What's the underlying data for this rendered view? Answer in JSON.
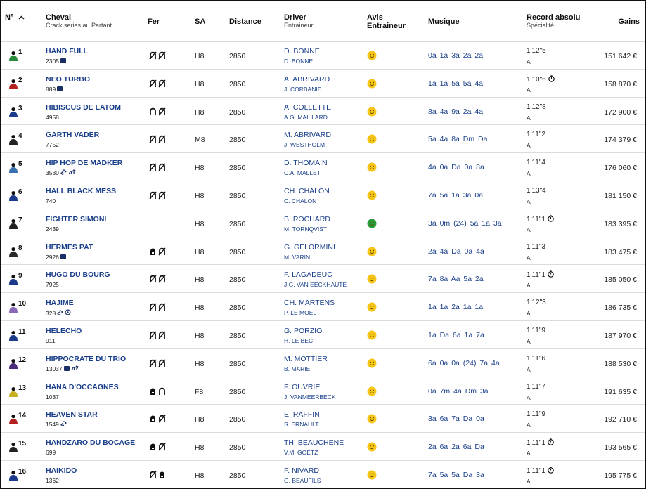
{
  "header": {
    "num_label": "N°",
    "horse_label": "Cheval",
    "horse_sub": "Crack series au Partant",
    "fer_label": "Fer",
    "sa_label": "SA",
    "distance_label": "Distance",
    "driver_label": "Driver",
    "driver_sub": "Entraineur",
    "avis_label": "Avis",
    "avis_label2": "Entraineur",
    "musique_label": "Musique",
    "record_label": "Record absolu",
    "record_sub": "Spécialité",
    "gains_label": "Gains"
  },
  "colors": {
    "link": "#1a3f8a",
    "smiley_neutral": "#f5c518",
    "smiley_good": "#2a9d3a"
  },
  "rows": [
    {
      "num": "1",
      "name": "HAND FULL",
      "crack": "2305",
      "icons": [
        "badge"
      ],
      "fer": [
        "ferre",
        "ferre"
      ],
      "sa": "H8",
      "distance": "2850",
      "driver": "D. BONNE",
      "trainer": "D. BONNE",
      "avis": "neutral",
      "musique": "0a  1a  3a  2a  2a",
      "record": "1'12\"5",
      "clock": false,
      "spec": "A",
      "gains": "151 642 €",
      "jockey": "#2a8a3a"
    },
    {
      "num": "2",
      "name": "NEO TURBO",
      "crack": "889",
      "icons": [
        "badge"
      ],
      "fer": [
        "ferre",
        "ferre"
      ],
      "sa": "H8",
      "distance": "2850",
      "driver": "A. ABRIVARD",
      "trainer": "J. CORBANIE",
      "avis": "neutral",
      "musique": "1a  1a  5a  5a  4a",
      "record": "1'10\"6",
      "clock": true,
      "spec": "A",
      "gains": "158 870 €",
      "jockey": "#b52020"
    },
    {
      "num": "3",
      "name": "HIBISCUS DE LATOM",
      "crack": "4958",
      "icons": [],
      "fer": [
        "deferre",
        "ferre"
      ],
      "sa": "H8",
      "distance": "2850",
      "driver": "A. COLLETTE",
      "trainer": "A.G. MAILLARD",
      "avis": "neutral",
      "musique": "8a  4a  9a  2a  4a",
      "record": "1'12\"8",
      "clock": false,
      "spec": "A",
      "gains": "172 900 €",
      "jockey": "#1b3a8a"
    },
    {
      "num": "4",
      "name": "GARTH VADER",
      "crack": "7752",
      "icons": [],
      "fer": [
        "ferre",
        "ferre"
      ],
      "sa": "M8",
      "distance": "2850",
      "driver": "M. ABRIVARD",
      "trainer": "J. WESTHOLM",
      "avis": "neutral",
      "musique": "5a  4a  8a  Dm  Da",
      "record": "1'11\"2",
      "clock": false,
      "spec": "A",
      "gains": "174 379 €",
      "jockey": "#222222"
    },
    {
      "num": "5",
      "name": "HIP HOP DE MADKER",
      "crack": "3530",
      "icons": [
        "link",
        "horse"
      ],
      "fer": [
        "ferre",
        "ferre"
      ],
      "sa": "H8",
      "distance": "2850",
      "driver": "D. THOMAIN",
      "trainer": "C.A. MALLET",
      "avis": "neutral",
      "musique": "4a  0a  Da  0a  8a",
      "record": "1'11\"4",
      "clock": false,
      "spec": "A",
      "gains": "176 060 €",
      "jockey": "#3a6fb0"
    },
    {
      "num": "6",
      "name": "HALL BLACK MESS",
      "crack": "740",
      "icons": [],
      "fer": [
        "ferre",
        "ferre"
      ],
      "sa": "H8",
      "distance": "2850",
      "driver": "CH. CHALON",
      "trainer": "C. CHALON",
      "avis": "neutral",
      "musique": "7a  5a  1a  3a  0a",
      "record": "1'13\"4",
      "clock": false,
      "spec": "A",
      "gains": "181 150 €",
      "jockey": "#1b3a8a"
    },
    {
      "num": "7",
      "name": "FIGHTER SIMONI",
      "crack": "2439",
      "icons": [],
      "fer": [],
      "sa": "H8",
      "distance": "2850",
      "driver": "B. ROCHARD",
      "trainer": "M. TORNQVIST",
      "avis": "good",
      "musique": "3a  0m  (24) 5a  1a  3a",
      "record": "1'11\"1",
      "clock": true,
      "spec": "A",
      "gains": "183 395 €",
      "jockey": "#222222"
    },
    {
      "num": "8",
      "name": "HERMES PAT",
      "crack": "2926",
      "icons": [
        "badge"
      ],
      "fer": [
        "plaque",
        "ferre"
      ],
      "sa": "H8",
      "distance": "2850",
      "driver": "G. GELORMINI",
      "trainer": "M. VARIN",
      "avis": "neutral",
      "musique": "2a  4a  Da  0a  4a",
      "record": "1'11\"3",
      "clock": false,
      "spec": "A",
      "gains": "183 475 €",
      "jockey": "#2a2a2a"
    },
    {
      "num": "9",
      "name": "HUGO DU BOURG",
      "crack": "7925",
      "icons": [],
      "fer": [
        "ferre",
        "ferre"
      ],
      "sa": "H8",
      "distance": "2850",
      "driver": "F. LAGADEUC",
      "trainer": "J.G. VAN EECKHAUTE",
      "avis": "neutral",
      "musique": "7a  8a  Aa  5a  2a",
      "record": "1'11\"1",
      "clock": true,
      "spec": "A",
      "gains": "185 050 €",
      "jockey": "#1b3a8a"
    },
    {
      "num": "10",
      "name": "HAJIME",
      "crack": "328",
      "icons": [
        "link",
        "flower"
      ],
      "fer": [
        "ferre",
        "ferre"
      ],
      "sa": "H8",
      "distance": "2850",
      "driver": "CH. MARTENS",
      "trainer": "P. LE MOEL",
      "avis": "neutral",
      "musique": "1a  1a  2a  1a  1a",
      "record": "1'12\"3",
      "clock": false,
      "spec": "A",
      "gains": "186 735 €",
      "jockey": "#8a6ab8"
    },
    {
      "num": "11",
      "name": "HELECHO",
      "crack": "911",
      "icons": [],
      "fer": [
        "ferre",
        "ferre"
      ],
      "sa": "H8",
      "distance": "2850",
      "driver": "G. PORZIO",
      "trainer": "H. LE BEC",
      "avis": "neutral",
      "musique": "1a  Da  6a  1a  7a",
      "record": "1'11\"9",
      "clock": false,
      "spec": "A",
      "gains": "187 970 €",
      "jockey": "#1b3a8a"
    },
    {
      "num": "12",
      "name": "HIPPOCRATE DU TRIO",
      "crack": "13037",
      "icons": [
        "badge",
        "horse"
      ],
      "fer": [
        "ferre",
        "ferre"
      ],
      "sa": "H8",
      "distance": "2850",
      "driver": "M. MOTTIER",
      "trainer": "B. MARIE",
      "avis": "neutral",
      "musique": "6a  0a  0a  (24) 7a  4a",
      "record": "1'11\"6",
      "clock": false,
      "spec": "A",
      "gains": "188 530 €",
      "jockey": "#4a2a7a"
    },
    {
      "num": "13",
      "name": "HANA D'OCCAGNES",
      "crack": "1037",
      "icons": [],
      "fer": [
        "plaque",
        "deferre"
      ],
      "sa": "F8",
      "distance": "2850",
      "driver": "F. OUVRIE",
      "trainer": "J. VANMEERBECK",
      "avis": "neutral",
      "musique": "0a  7m  4a  Dm  3a",
      "record": "1'11\"7",
      "clock": false,
      "spec": "A",
      "gains": "191 635 €",
      "jockey": "#c8b020"
    },
    {
      "num": "14",
      "name": "HEAVEN STAR",
      "crack": "1549",
      "icons": [
        "link"
      ],
      "fer": [
        "plaque",
        "ferre"
      ],
      "sa": "H8",
      "distance": "2850",
      "driver": "E. RAFFIN",
      "trainer": "S. ERNAULT",
      "avis": "neutral",
      "musique": "3a  6a  7a  Da  0a",
      "record": "1'11\"9",
      "clock": false,
      "spec": "A",
      "gains": "192 710 €",
      "jockey": "#b52020"
    },
    {
      "num": "15",
      "name": "HANDZARO DU BOCAGE",
      "crack": "699",
      "icons": [],
      "fer": [
        "plaque",
        "ferre"
      ],
      "sa": "H8",
      "distance": "2850",
      "driver": "TH. BEAUCHENE",
      "trainer": "V.M. GOETZ",
      "avis": "neutral",
      "musique": "2a  6a  2a  6a  Da",
      "record": "1'11\"1",
      "clock": true,
      "spec": "A",
      "gains": "193 565 €",
      "jockey": "#222222"
    },
    {
      "num": "16",
      "name": "HAIKIDO",
      "crack": "1362",
      "icons": [],
      "fer": [
        "ferre",
        "plaque"
      ],
      "sa": "H8",
      "distance": "2850",
      "driver": "F. NIVARD",
      "trainer": "G. BEAUFILS",
      "avis": "neutral",
      "musique": "7a  5a  5a  Da  3a",
      "record": "1'11\"1",
      "clock": true,
      "spec": "A",
      "gains": "195 775 €",
      "jockey": "#1b3a8a"
    }
  ]
}
